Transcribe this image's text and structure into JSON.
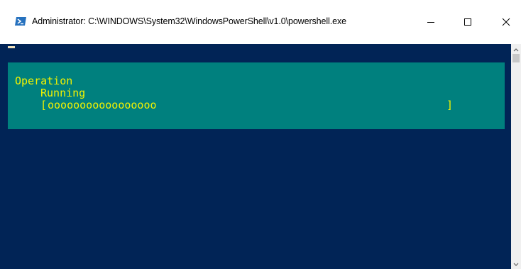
{
  "window": {
    "title": "Administrator: C:\\WINDOWS\\System32\\WindowsPowerShell\\v1.0\\powershell.exe",
    "icon": "powershell-icon",
    "controls": {
      "minimize_icon": "minimize-icon",
      "maximize_icon": "maximize-icon",
      "close_icon": "close-icon"
    }
  },
  "console": {
    "background": "#012456",
    "cursor_color": "#eedfba",
    "progress": {
      "panel_background": "#00807e",
      "text_color": "#f2f200",
      "activity": "Operation",
      "status": "Running",
      "bar_open": "[",
      "bar_fill": "ooooooooooooooooo",
      "bar_close": "]"
    }
  },
  "scrollbar": {
    "up_icon": "scroll-up-arrow-icon",
    "down_icon": "scroll-down-arrow-icon"
  }
}
